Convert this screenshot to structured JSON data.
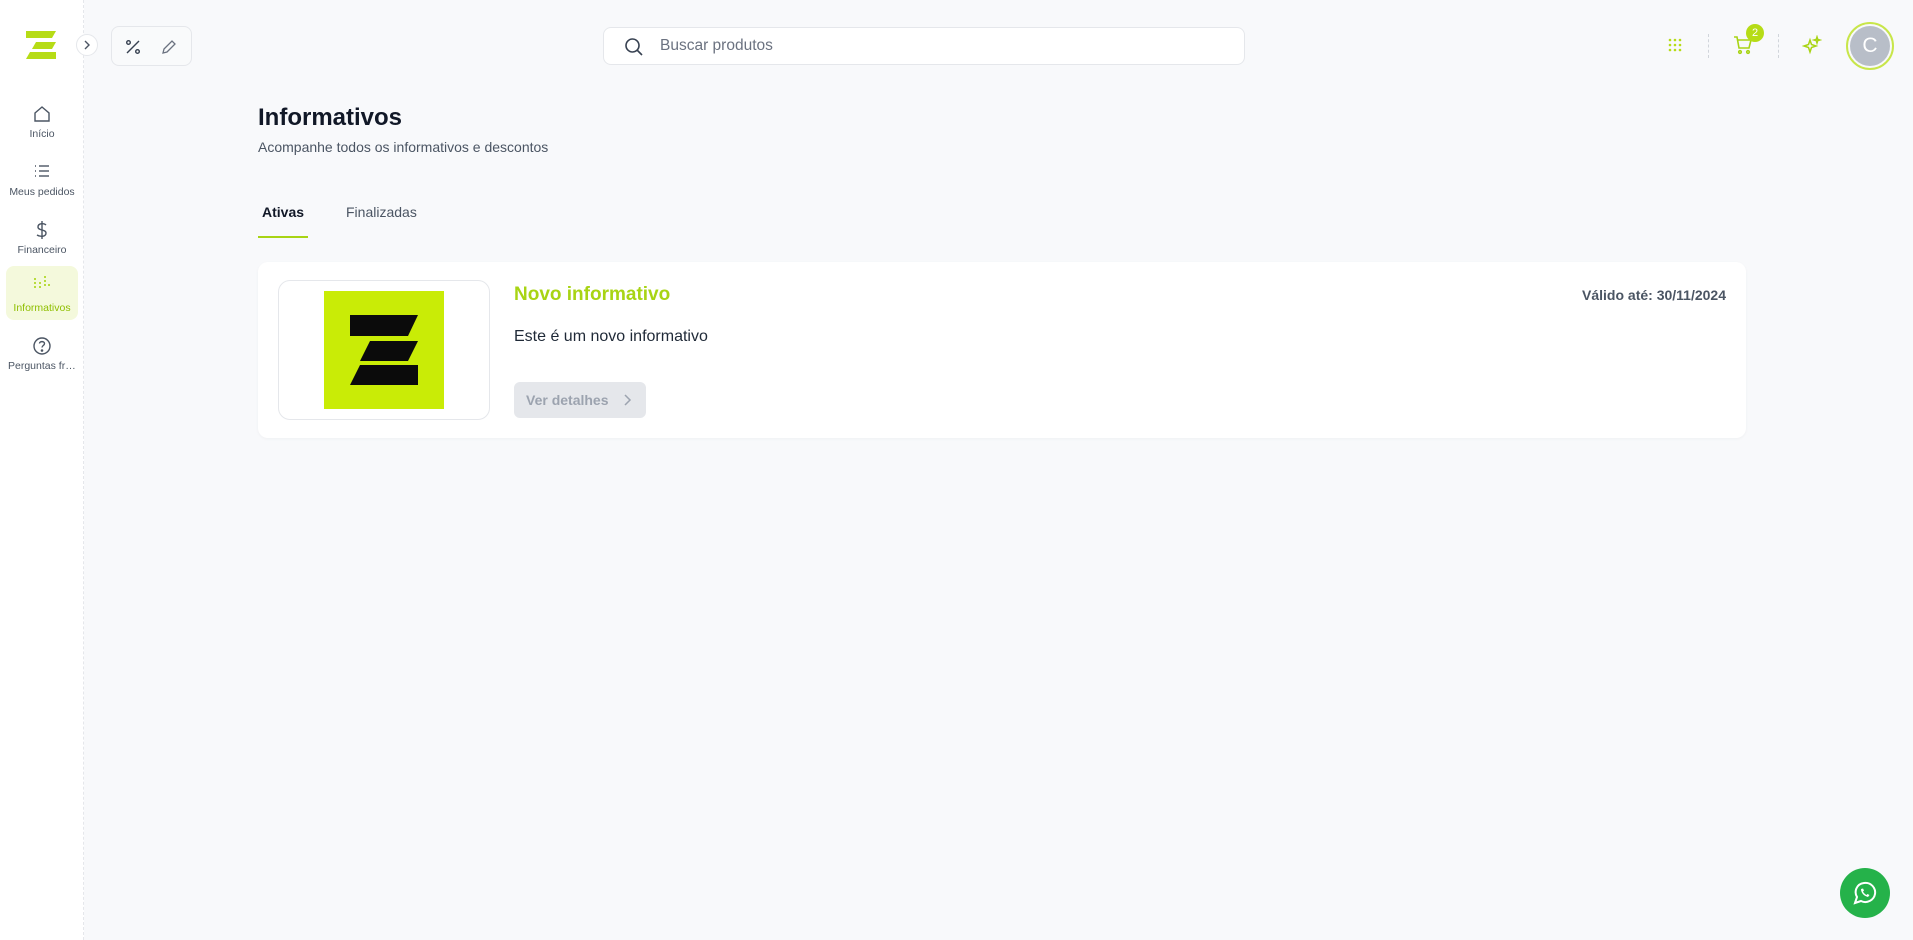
{
  "sidebar": {
    "items": [
      {
        "label": "Início",
        "icon": "home-icon"
      },
      {
        "label": "Meus pedidos",
        "icon": "list-icon"
      },
      {
        "label": "Financeiro",
        "icon": "dollar-icon"
      },
      {
        "label": "Informativos",
        "icon": "bar-equalizer-icon",
        "active": true
      },
      {
        "label": "Perguntas fre...",
        "icon": "help-circle-icon"
      }
    ]
  },
  "search": {
    "placeholder": "Buscar produtos",
    "value": ""
  },
  "header": {
    "cart_count": "2",
    "avatar_initial": "C"
  },
  "page": {
    "title": "Informativos",
    "subtitle": "Acompanhe todos os informativos e descontos"
  },
  "tabs": [
    {
      "label": "Ativas",
      "active": true
    },
    {
      "label": "Finalizadas",
      "active": false
    }
  ],
  "card": {
    "title": "Novo informativo",
    "valid_until": "Válido até: 30/11/2024",
    "description": "Este é um novo informativo",
    "button_label": "Ver detalhes"
  },
  "colors": {
    "accent": "#a8d414",
    "brand_logo": "#c9ec06",
    "whatsapp": "#25b24a"
  }
}
